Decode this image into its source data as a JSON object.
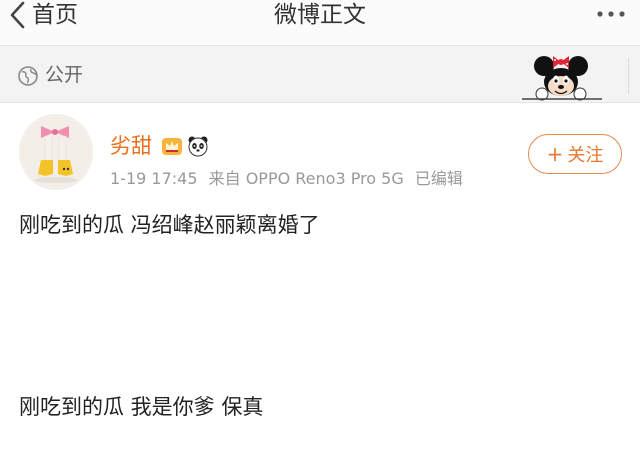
{
  "header": {
    "back_label": "首页",
    "title": "微博正文",
    "more_icon": "more-dots-icon"
  },
  "visibility": {
    "icon": "globe-icon",
    "label": "公开",
    "decoration": "minnie-mouse-sticker"
  },
  "post": {
    "author": {
      "name": "劣甜",
      "badges": [
        "crown-badge-icon",
        "panda-emoji-icon"
      ],
      "avatar": "avatar-yellow-boots"
    },
    "time": "1-19 17:45",
    "source": "来自 OPPO Reno3 Pro 5G",
    "edited": "已编辑",
    "follow_button": {
      "plus": "+",
      "label": "关注"
    },
    "lines": [
      "刚吃到的瓜 冯绍峰赵丽颖离婚了",
      "刚吃到的瓜 我是你爹 保真"
    ]
  },
  "colors": {
    "username": "#ea6f1c",
    "follow_accent": "#e8782d",
    "meta_text": "#999999",
    "bar_background": "#f3f3f3"
  }
}
